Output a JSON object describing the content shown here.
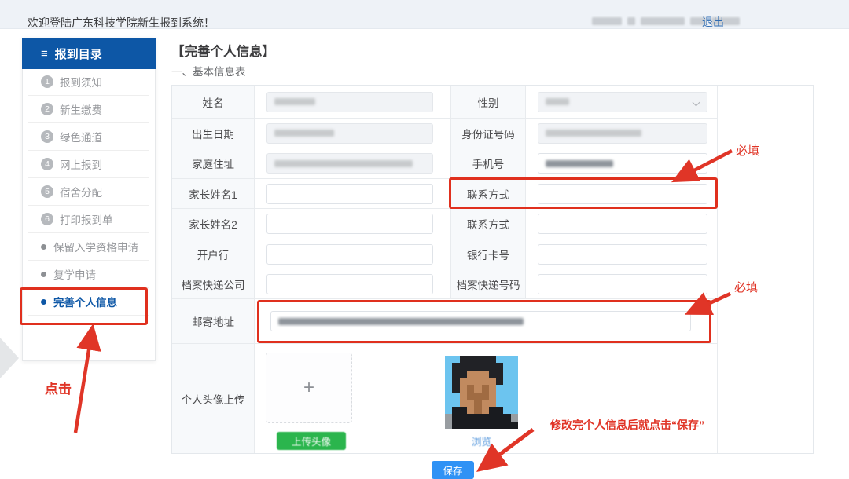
{
  "header": {
    "welcome": "欢迎登陆广东科技学院新生报到系统！",
    "logout": "退出"
  },
  "sidebar": {
    "title": "报到目录",
    "menu_icon": "hamburger-icon",
    "items": [
      {
        "num": "1",
        "label": "报到须知"
      },
      {
        "num": "2",
        "label": "新生缴费"
      },
      {
        "num": "3",
        "label": "绿色通道"
      },
      {
        "num": "4",
        "label": "网上报到"
      },
      {
        "num": "5",
        "label": "宿舍分配"
      },
      {
        "num": "6",
        "label": "打印报到单"
      },
      {
        "label": "保留入学资格申请"
      },
      {
        "label": "复学申请"
      },
      {
        "label": "完善个人信息",
        "active": true
      }
    ]
  },
  "main": {
    "title": "【完善个人信息】",
    "subtitle": "一、基本信息表",
    "form": {
      "rows": [
        {
          "label1": "姓名",
          "label2": "性别"
        },
        {
          "label1": "出生日期",
          "label2": "身份证号码"
        },
        {
          "label1": "家庭住址",
          "label2": "手机号"
        },
        {
          "label1": "家长姓名1",
          "label2": "联系方式"
        },
        {
          "label1": "家长姓名2",
          "label2": "联系方式"
        },
        {
          "label1": "开户行",
          "label2": "银行卡号"
        },
        {
          "label1": "档案快递公司",
          "label2": "档案快递号码"
        }
      ],
      "mail_label": "邮寄地址",
      "avatar_label": "个人头像上传",
      "upload_button": "上传头像",
      "browse_link": "浏览",
      "plus_sign": "+",
      "avatar_photo": {
        "palette": {
          "B": "#6cc4ef",
          "H": "#212226",
          "F": "#c18a5f",
          "f": "#a06b42",
          "D": "#191b1f",
          "G": "#989da1"
        },
        "pixels": [
          "BBHHHHHBBB",
          "BHHHHHHHBB",
          "BHHFFFHHBB",
          "BHFFFFFHBB",
          "BHFfFfFBBB",
          "BBFfffFBBB",
          "BBFFfFFBBB",
          "BDDFfFDDBB",
          "GDDDDDDDDG",
          "GDDDDDDDDD"
        ]
      }
    },
    "save_button": "保存"
  },
  "annotations": {
    "click": "点击",
    "required_top": "必填",
    "required_mail": "必填",
    "save_note": "修改完个人信息后就点击“保存”"
  },
  "colors": {
    "accent_blue": "#0d57a6",
    "annotation_red": "#e03527",
    "save_blue": "#2f92f5",
    "upload_green": "#2bb54d",
    "link_blue": "#2e6cb3"
  }
}
